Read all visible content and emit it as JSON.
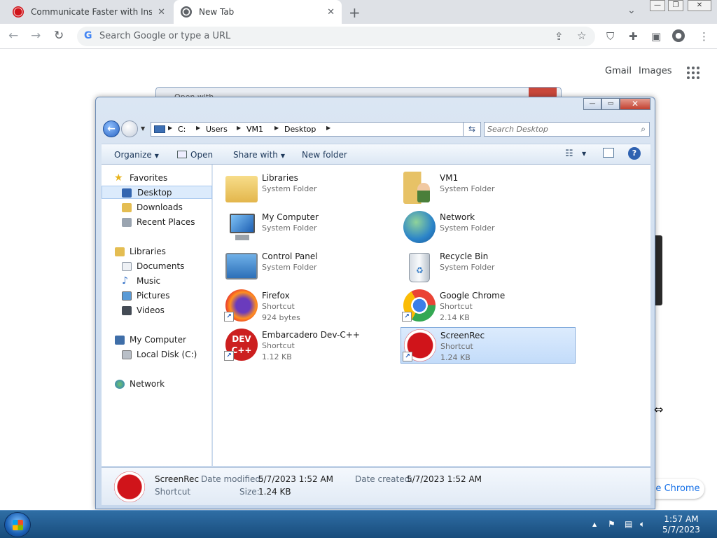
{
  "browser": {
    "tabs": [
      {
        "title": "Communicate Faster with Instant",
        "active": false
      },
      {
        "title": "New Tab",
        "active": true
      }
    ],
    "omnibox_placeholder": "Search Google or type a URL",
    "ntp": {
      "gmail": "Gmail",
      "images": "Images",
      "customize": "ize Chrome"
    }
  },
  "ghost_dialog": {
    "title": "Open with"
  },
  "explorer": {
    "breadcrumbs": [
      "C:",
      "Users",
      "VM1",
      "Desktop"
    ],
    "search_placeholder": "Search Desktop",
    "commands": {
      "organize": "Organize",
      "open": "Open",
      "share_with": "Share with",
      "new_folder": "New folder"
    },
    "nav": {
      "favorites": "Favorites",
      "desktop": "Desktop",
      "downloads": "Downloads",
      "recent_places": "Recent Places",
      "libraries": "Libraries",
      "documents": "Documents",
      "music": "Music",
      "pictures": "Pictures",
      "videos": "Videos",
      "my_computer": "My Computer",
      "local_disk": "Local Disk (C:)",
      "network": "Network"
    },
    "items": [
      {
        "name": "Libraries",
        "type": "System Folder",
        "size": ""
      },
      {
        "name": "VM1",
        "type": "System Folder",
        "size": ""
      },
      {
        "name": "My Computer",
        "type": "System Folder",
        "size": ""
      },
      {
        "name": "Network",
        "type": "System Folder",
        "size": ""
      },
      {
        "name": "Control Panel",
        "type": "System Folder",
        "size": ""
      },
      {
        "name": "Recycle Bin",
        "type": "System Folder",
        "size": ""
      },
      {
        "name": "Firefox",
        "type": "Shortcut",
        "size": "924 bytes"
      },
      {
        "name": "Google Chrome",
        "type": "Shortcut",
        "size": "2.14 KB"
      },
      {
        "name": "Embarcadero Dev-C++",
        "type": "Shortcut",
        "size": "1.12 KB"
      },
      {
        "name": "ScreenRec",
        "type": "Shortcut",
        "size": "1.24 KB"
      }
    ],
    "details": {
      "name": "ScreenRec",
      "type": "Shortcut",
      "date_modified_label": "Date modified:",
      "date_modified": "5/7/2023 1:52 AM",
      "date_created_label": "Date created:",
      "date_created": "5/7/2023 1:52 AM",
      "size_label": "Size:",
      "size": "1.24 KB"
    }
  },
  "taskbar": {
    "time": "1:57 AM",
    "date": "5/7/2023"
  },
  "colors": {
    "screenrec_red": "#d0141a",
    "taskbar": "#1f5a90",
    "selection": "#cfe3fb"
  }
}
